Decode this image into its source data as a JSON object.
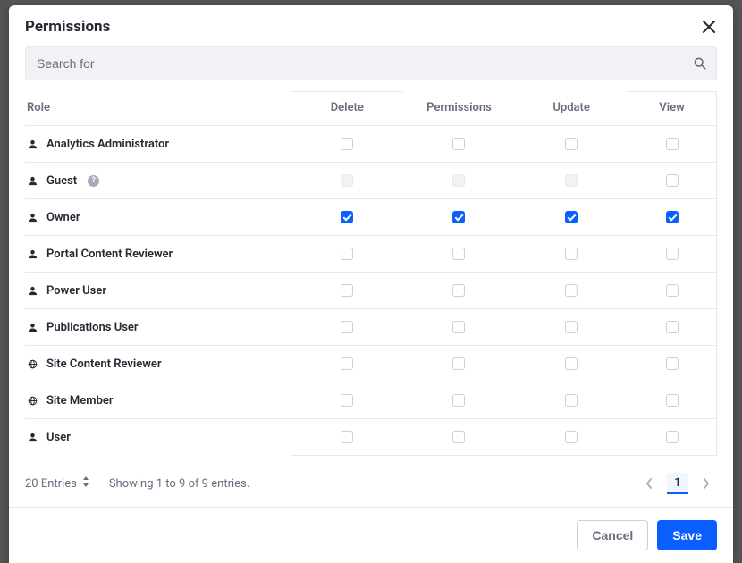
{
  "modal": {
    "title": "Permissions"
  },
  "search": {
    "placeholder": "Search for"
  },
  "table": {
    "headers": {
      "role": "Role",
      "delete": "Delete",
      "permissions": "Permissions",
      "update": "Update",
      "view": "View"
    },
    "rows": [
      {
        "icon": "user",
        "label": "Analytics Administrator",
        "help": false,
        "delete": {
          "checked": false,
          "disabled": false
        },
        "permissions": {
          "checked": false,
          "disabled": false
        },
        "update": {
          "checked": false,
          "disabled": false
        },
        "view": {
          "checked": false,
          "disabled": false
        }
      },
      {
        "icon": "user",
        "label": "Guest",
        "help": true,
        "delete": {
          "checked": false,
          "disabled": true
        },
        "permissions": {
          "checked": false,
          "disabled": true
        },
        "update": {
          "checked": false,
          "disabled": true
        },
        "view": {
          "checked": false,
          "disabled": false
        }
      },
      {
        "icon": "user",
        "label": "Owner",
        "help": false,
        "delete": {
          "checked": true,
          "disabled": false
        },
        "permissions": {
          "checked": true,
          "disabled": false
        },
        "update": {
          "checked": true,
          "disabled": false
        },
        "view": {
          "checked": true,
          "disabled": false
        }
      },
      {
        "icon": "user",
        "label": "Portal Content Reviewer",
        "help": false,
        "delete": {
          "checked": false,
          "disabled": false
        },
        "permissions": {
          "checked": false,
          "disabled": false
        },
        "update": {
          "checked": false,
          "disabled": false
        },
        "view": {
          "checked": false,
          "disabled": false
        }
      },
      {
        "icon": "user",
        "label": "Power User",
        "help": false,
        "delete": {
          "checked": false,
          "disabled": false
        },
        "permissions": {
          "checked": false,
          "disabled": false
        },
        "update": {
          "checked": false,
          "disabled": false
        },
        "view": {
          "checked": false,
          "disabled": false
        }
      },
      {
        "icon": "user",
        "label": "Publications User",
        "help": false,
        "delete": {
          "checked": false,
          "disabled": false
        },
        "permissions": {
          "checked": false,
          "disabled": false
        },
        "update": {
          "checked": false,
          "disabled": false
        },
        "view": {
          "checked": false,
          "disabled": false
        }
      },
      {
        "icon": "globe",
        "label": "Site Content Reviewer",
        "help": false,
        "delete": {
          "checked": false,
          "disabled": false
        },
        "permissions": {
          "checked": false,
          "disabled": false
        },
        "update": {
          "checked": false,
          "disabled": false
        },
        "view": {
          "checked": false,
          "disabled": false
        }
      },
      {
        "icon": "globe",
        "label": "Site Member",
        "help": false,
        "delete": {
          "checked": false,
          "disabled": false
        },
        "permissions": {
          "checked": false,
          "disabled": false
        },
        "update": {
          "checked": false,
          "disabled": false
        },
        "view": {
          "checked": false,
          "disabled": false
        }
      },
      {
        "icon": "user",
        "label": "User",
        "help": false,
        "delete": {
          "checked": false,
          "disabled": false
        },
        "permissions": {
          "checked": false,
          "disabled": false
        },
        "update": {
          "checked": false,
          "disabled": false
        },
        "view": {
          "checked": false,
          "disabled": false
        }
      }
    ]
  },
  "pagination": {
    "page_size_label": "20 Entries",
    "showing_text": "Showing 1 to 9 of 9 entries.",
    "current_page": "1"
  },
  "actions": {
    "cancel": "Cancel",
    "save": "Save"
  },
  "help_glyph": "?"
}
